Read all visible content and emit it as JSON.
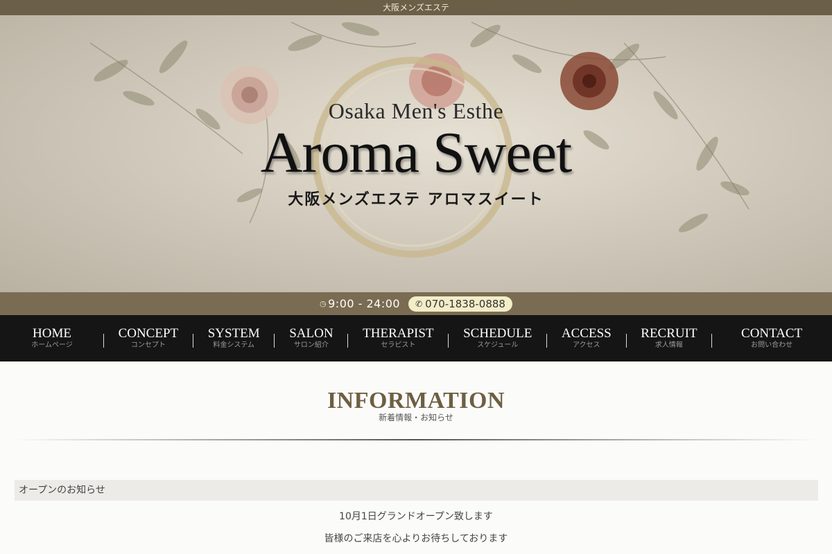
{
  "topbar": {
    "text": "大阪メンズエステ"
  },
  "hero": {
    "logo_subtitle": "Osaka Men's Esthe",
    "logo_title": "Aroma Sweet",
    "logo_japanese": "大阪メンズエステ アロマスイート"
  },
  "hours_bar": {
    "clock_icon": "clock-icon",
    "hours": "9:00 - 24:00",
    "phone_icon": "phone-icon",
    "phone": "070-1838-0888"
  },
  "nav": {
    "items": [
      {
        "en": "HOME",
        "jp": "ホームページ"
      },
      {
        "en": "CONCEPT",
        "jp": "コンセプト"
      },
      {
        "en": "SYSTEM",
        "jp": "料金システム"
      },
      {
        "en": "SALON",
        "jp": "サロン紹介"
      },
      {
        "en": "THERAPIST",
        "jp": "セラピスト"
      },
      {
        "en": "SCHEDULE",
        "jp": "スケジュール"
      },
      {
        "en": "ACCESS",
        "jp": "アクセス"
      },
      {
        "en": "RECRUIT",
        "jp": "求人情報"
      },
      {
        "en": "CONTACT",
        "jp": "お問い合わせ"
      }
    ]
  },
  "information": {
    "title": "INFORMATION",
    "subtitle": "新着情報・お知らせ",
    "news_heading": "オープンのお知らせ",
    "news_line1": "10月1日グランドオープン致します",
    "news_line2": "皆様のご来店を心よりお待ちしております"
  },
  "colors": {
    "topbar": "#6b5f47",
    "hours_bar": "#7a6c52",
    "phone_pill": "#f3edc8",
    "nav_bg": "#151515",
    "accent": "#6e5f42"
  }
}
